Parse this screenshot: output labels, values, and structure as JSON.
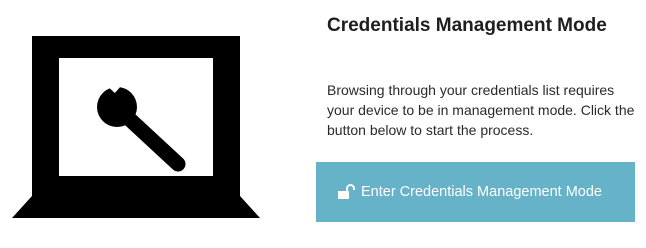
{
  "panel": {
    "title": "Credentials Management Mode",
    "description": "Browsing through your credentials list requires your device to be in management mode. Click the button below to start the process."
  },
  "illustration": {
    "icon": "laptop-wrench-icon"
  },
  "action_button": {
    "label": "Enter Credentials Management Mode",
    "icon": "unlock-icon",
    "background_color": "#66b2c8",
    "text_color": "#ffffff"
  }
}
